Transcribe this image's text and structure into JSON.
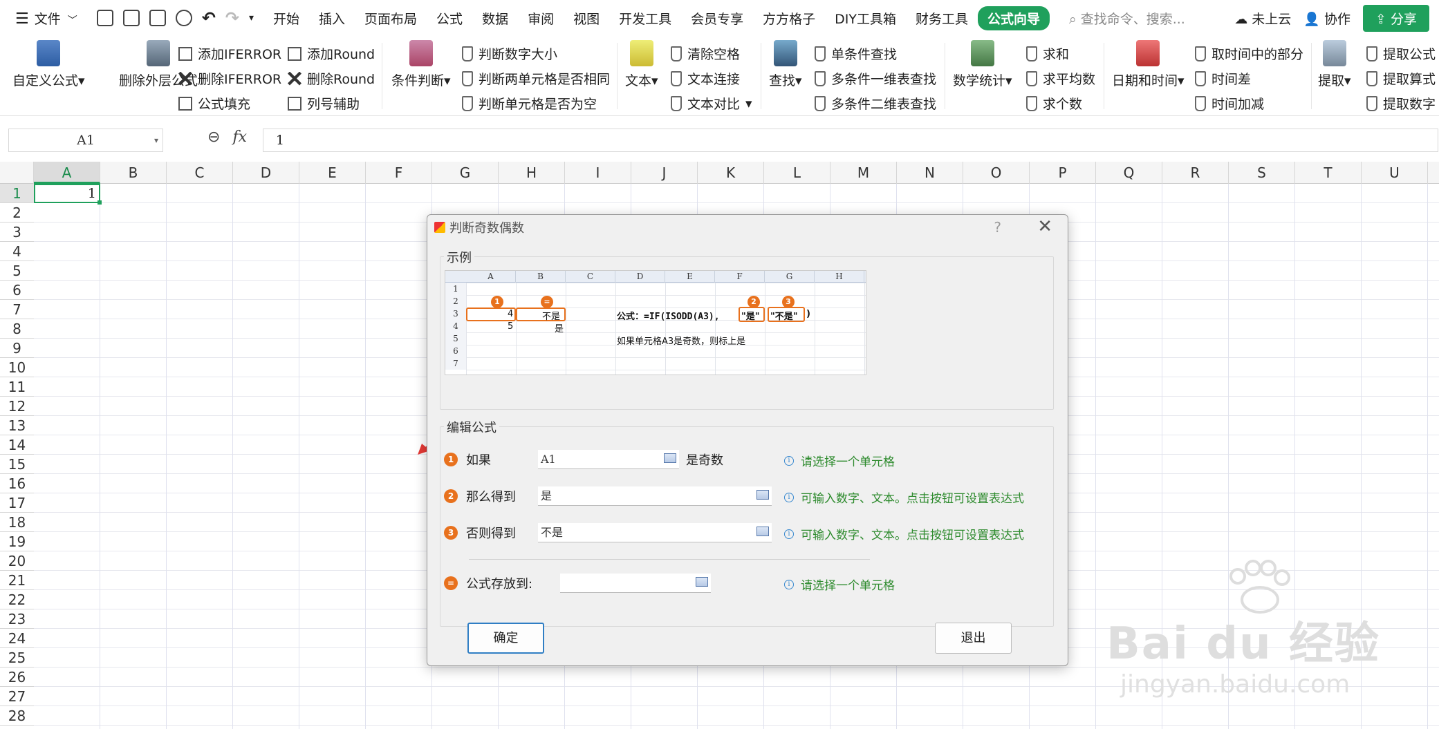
{
  "menu": {
    "file": "文件",
    "tabs": [
      "开始",
      "插入",
      "页面布局",
      "公式",
      "数据",
      "审阅",
      "视图",
      "开发工具",
      "会员专享",
      "方方格子",
      "DIY工具箱",
      "财务工具",
      "公式向导"
    ],
    "active_tab": "公式向导",
    "search_placeholder": "查找命令、搜索...",
    "cloud": "未上云",
    "collab": "协作",
    "share": "分享"
  },
  "ribbon": {
    "custom_formula": "自定义公式",
    "remove_outer": "删除外层公式",
    "add_iferror": "添加IFERROR",
    "remove_iferror": "删除IFERROR",
    "formula_fill": "公式填充",
    "add_round": "添加Round",
    "remove_round": "删除Round",
    "col_helper": "列号辅助",
    "condition": "条件判断",
    "cmp_num": "判断数字大小",
    "cmp_two": "判断两单元格是否相同",
    "is_empty": "判断单元格是否为空",
    "text": "文本",
    "clear_space": "清除空格",
    "text_join": "文本连接",
    "text_cmp": "文本对比",
    "find": "查找",
    "single_find": "单条件查找",
    "multi_1d": "多条件一维表查找",
    "multi_2d": "多条件二维表查找",
    "math": "数学统计",
    "sum": "求和",
    "avg": "求平均数",
    "count": "求个数",
    "datetime": "日期和时间",
    "time_part": "取时间中的部分",
    "time_diff": "时间差",
    "time_add": "时间加减",
    "extract": "提取",
    "extract_formula": "提取公式",
    "extract_expr": "提取算式",
    "extract_num": "提取数字"
  },
  "formula_bar": {
    "name_box": "A1",
    "fx": "fx",
    "value": "1"
  },
  "sheet": {
    "columns": [
      "A",
      "B",
      "C",
      "D",
      "E",
      "F",
      "G",
      "H",
      "I",
      "J",
      "K",
      "L",
      "M",
      "N",
      "O",
      "P",
      "Q",
      "R",
      "S",
      "T",
      "U"
    ],
    "rows": [
      "1",
      "2",
      "3",
      "4",
      "5",
      "6",
      "7",
      "8",
      "9",
      "10",
      "11",
      "12",
      "13",
      "14",
      "15",
      "16",
      "17",
      "18",
      "19",
      "20",
      "21",
      "22",
      "23",
      "24",
      "25",
      "26",
      "27",
      "28"
    ],
    "a1_value": "1"
  },
  "dialog": {
    "title": "判断奇数偶数",
    "help": "?",
    "example_label": "示例",
    "example": {
      "cols": [
        "A",
        "B",
        "C",
        "D",
        "E",
        "F",
        "G",
        "H"
      ],
      "rows": [
        "1",
        "2",
        "3",
        "4",
        "5",
        "6",
        "7"
      ],
      "a3": "4",
      "b3": "不是",
      "a4": "5",
      "b4": "是",
      "formula_prefix": "公式：=IF(ISODD(A3),",
      "arg2": "\"是\"",
      "arg3": "\"不是\"",
      "formula_suffix": ")",
      "note": "如果单元格A3是奇数，则标上是",
      "c1": "1",
      "c2": "2",
      "c3": "3",
      "ceq": "="
    },
    "edit_label": "编辑公式",
    "if_label": "如果",
    "if_value": "A1",
    "if_suffix": "是奇数",
    "if_hint": "请选择一个单元格",
    "then_label": "那么得到",
    "then_value": "是",
    "then_hint": "可输入数字、文本。点击按钮可设置表达式",
    "else_label": "否则得到",
    "else_value": "不是",
    "else_hint": "可输入数字、文本。点击按钮可设置表达式",
    "store_label": "公式存放到:",
    "store_value": "",
    "store_hint": "请选择一个单元格",
    "n1": "1",
    "n2": "2",
    "n3": "3",
    "neq": "=",
    "ok": "确定",
    "exit": "退出"
  },
  "watermark": {
    "brand": "Bai du 经验",
    "url": "jingyan.baidu.com"
  },
  "colors": {
    "accent_green": "#1fa05c",
    "orange": "#e8711d",
    "hint_green": "#2e8b2e"
  }
}
